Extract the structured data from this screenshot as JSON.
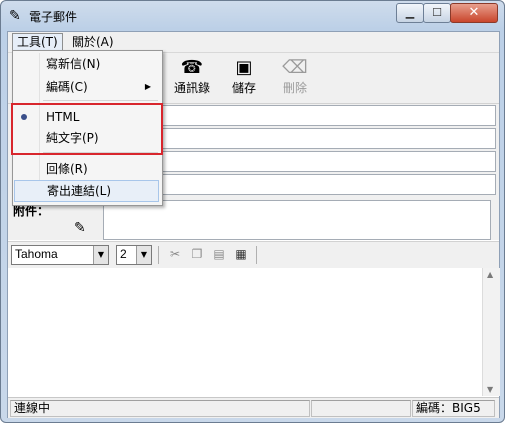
{
  "window": {
    "title": "電子郵件",
    "icon": "pen-icon"
  },
  "menubar": {
    "items": [
      "工具(T)",
      "關於(A)"
    ]
  },
  "toolbar": {
    "buttons": [
      {
        "label": "通訊錄",
        "icon": "phone-icon",
        "enabled": true
      },
      {
        "label": "儲存",
        "icon": "save-icon",
        "enabled": true
      },
      {
        "label": "刪除",
        "icon": "delete-icon",
        "enabled": false
      }
    ]
  },
  "attachment": {
    "label": "附件：",
    "icon": "attach-edit-icon"
  },
  "format": {
    "font": "Tahoma",
    "size": "2"
  },
  "dropdown": {
    "items": [
      {
        "label": "寫新信(N)"
      },
      {
        "label": "編碼(C)",
        "submenu": true
      },
      {
        "label": "HTML",
        "checked": true
      },
      {
        "label": "純文字(P)"
      },
      {
        "label": "回條(R)"
      },
      {
        "label": "寄出連結(L)"
      }
    ]
  },
  "status": {
    "left": "連線中",
    "right": "編碼：BIG5"
  },
  "colors": {
    "highlight": "#d8262d",
    "close": "#c9462c"
  }
}
